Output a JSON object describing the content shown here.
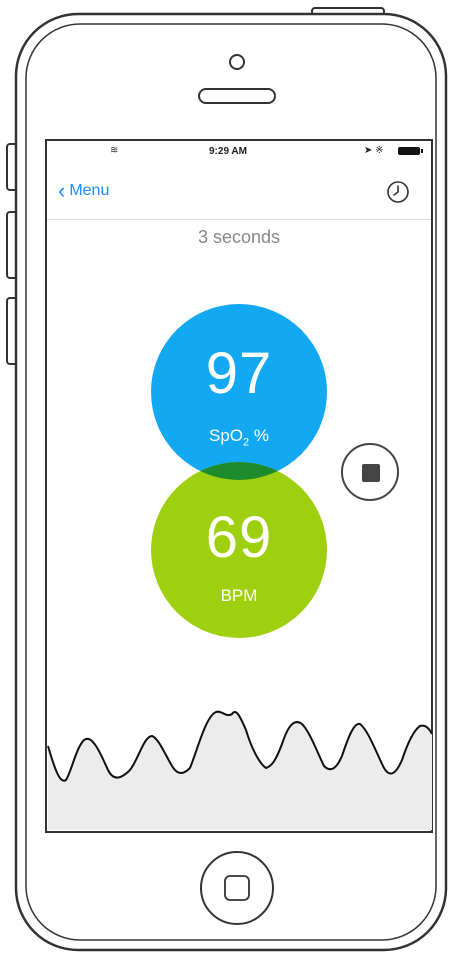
{
  "status_bar": {
    "time": "9:29 AM",
    "wifi_icon": "wifi-icon",
    "right_icons": "location-icon bluetooth-icon",
    "battery_icon": "battery-icon"
  },
  "nav": {
    "back_label": "Menu",
    "back_icon": "chevron-left-icon",
    "history_icon": "clock-icon",
    "accent": "#1a8cff"
  },
  "timer": {
    "label": "3 seconds"
  },
  "readings": {
    "spo2": {
      "value": "97",
      "unit_main": "SpO",
      "unit_sub": "2",
      "unit_suffix": " %",
      "color": "#12a8f2"
    },
    "bpm": {
      "value": "69",
      "unit": "BPM",
      "color": "#9fd00f"
    }
  },
  "controls": {
    "stop_icon": "stop-icon"
  }
}
